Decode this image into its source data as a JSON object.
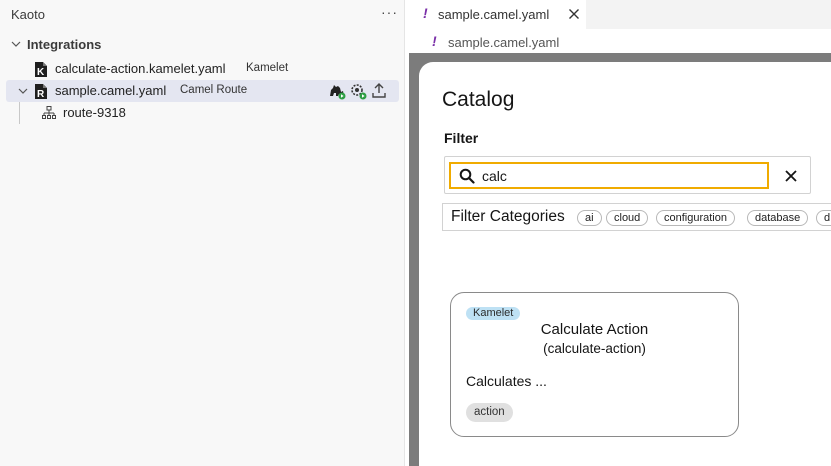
{
  "sidebar": {
    "title": "Kaoto",
    "more_label": "···",
    "section": {
      "label": "Integrations"
    },
    "items": [
      {
        "name": "calculate-action.kamelet.yaml",
        "kind": "Kamelet",
        "icon_letter": "K"
      },
      {
        "name": "sample.camel.yaml",
        "kind": "Camel Route",
        "icon_letter": "R"
      },
      {
        "name": "route-9318"
      }
    ],
    "row_actions": [
      "camel-run-icon",
      "settings-run-icon",
      "export-icon"
    ]
  },
  "editor": {
    "tab": {
      "marker": "!",
      "label": "sample.camel.yaml"
    },
    "breadcrumb": {
      "marker": "!",
      "label": "sample.camel.yaml"
    }
  },
  "catalog": {
    "title": "Catalog",
    "filter_label": "Filter",
    "search_value": "calc",
    "categories_label": "Filter Categories",
    "categories": [
      "ai",
      "cloud",
      "configuration",
      "database",
      "d"
    ],
    "card": {
      "badge": "Kamelet",
      "title": "Calculate Action",
      "subtitle": "(calculate-action)",
      "description": "Calculates ...",
      "tag": "action"
    }
  },
  "colors": {
    "accent_focus": "#f0ab00",
    "kamelet_badge": "#bee1f4",
    "yaml_marker": "#7a2fa8",
    "selected_row": "#e4e6f1",
    "overlay": "#7c7c7c"
  }
}
